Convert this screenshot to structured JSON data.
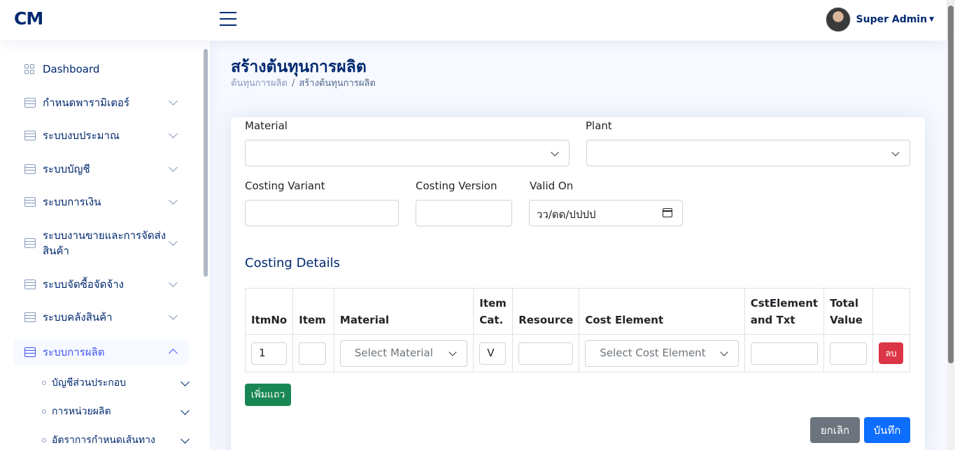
{
  "header": {
    "logo": "CM",
    "user_name": "Super Admin"
  },
  "sidebar": {
    "items": [
      {
        "label": "Dashboard"
      },
      {
        "label": "กำหนดพารามิเตอร์"
      },
      {
        "label": "ระบบงบประมาณ"
      },
      {
        "label": "ระบบบัญชี"
      },
      {
        "label": "ระบบการเงิน"
      },
      {
        "label": "ระบบงานขายและการจัดส่ง",
        "label2": "สินค้า"
      },
      {
        "label": "ระบบจัดซื้อจัดจ้าง"
      },
      {
        "label": "ระบบคลังสินค้า"
      },
      {
        "label": "ระบบการผลิต"
      }
    ],
    "sub_items": [
      {
        "label": "บัญชีส่วนประกอบ"
      },
      {
        "label": "การหน่วยผลิต"
      },
      {
        "label": "อัตราการกำหนดเส้นทาง"
      }
    ]
  },
  "page": {
    "title": "สร้างต้นทุนการผลิต",
    "breadcrumb": [
      "ต้นทุนการผลิต",
      "สร้างต้นทุนการผลิต"
    ],
    "breadcrumb_sep": "/"
  },
  "form": {
    "material_label": "Material",
    "plant_label": "Plant",
    "costing_variant_label": "Costing Variant",
    "costing_version_label": "Costing Version",
    "valid_on_label": "Valid On",
    "valid_on_placeholder": "วว/ดด/ปปปป"
  },
  "details": {
    "title": "Costing Details",
    "columns": {
      "itmno": "ItmNo",
      "item": "Item",
      "material": "Material",
      "item_cat_1": "Item",
      "item_cat_2": "Cat.",
      "resource": "Resource",
      "cost_element": "Cost Element",
      "cst_1": "CstElement",
      "cst_2": "and Txt",
      "total_1": "Total",
      "total_2": "Value"
    },
    "row": {
      "itmno": "1",
      "material_placeholder": "Select Material",
      "item_cat": "V",
      "cost_element_placeholder": "Select Cost Element",
      "delete_label": "ลบ"
    },
    "add_row_label": "เพิ่มแถว"
  },
  "actions": {
    "cancel_label": "ยกเลิก",
    "save_label": "บันทึก"
  }
}
